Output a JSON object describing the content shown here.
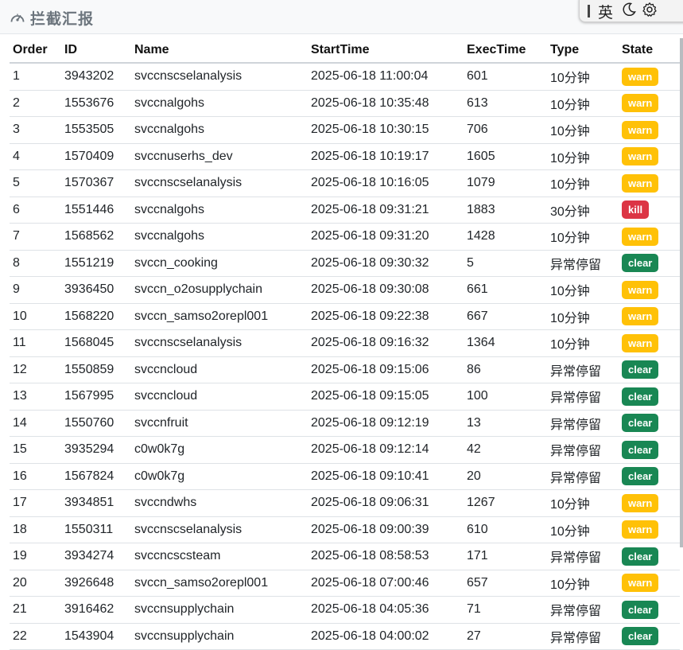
{
  "header": {
    "title": "拦截汇报",
    "icon": "gauge-icon"
  },
  "toolbar": {
    "lang_label": "英",
    "icons": [
      "separator-bar-icon",
      "moon-icon",
      "gear-icon"
    ]
  },
  "table": {
    "columns": [
      "Order",
      "ID",
      "Name",
      "StartTime",
      "ExecTime",
      "Type",
      "State"
    ],
    "rows": [
      [
        "1",
        "3943202",
        "svccnscselanalysis",
        "2025-06-18 11:00:04",
        "601",
        "10分钟",
        "warn"
      ],
      [
        "2",
        "1553676",
        "svccnalgohs",
        "2025-06-18 10:35:48",
        "613",
        "10分钟",
        "warn"
      ],
      [
        "3",
        "1553505",
        "svccnalgohs",
        "2025-06-18 10:30:15",
        "706",
        "10分钟",
        "warn"
      ],
      [
        "4",
        "1570409",
        "svccnuserhs_dev",
        "2025-06-18 10:19:17",
        "1605",
        "10分钟",
        "warn"
      ],
      [
        "5",
        "1570367",
        "svccnscselanalysis",
        "2025-06-18 10:16:05",
        "1079",
        "10分钟",
        "warn"
      ],
      [
        "6",
        "1551446",
        "svccnalgohs",
        "2025-06-18 09:31:21",
        "1883",
        "30分钟",
        "kill"
      ],
      [
        "7",
        "1568562",
        "svccnalgohs",
        "2025-06-18 09:31:20",
        "1428",
        "10分钟",
        "warn"
      ],
      [
        "8",
        "1551219",
        "svccn_cooking",
        "2025-06-18 09:30:32",
        "5",
        "异常停留",
        "clear"
      ],
      [
        "9",
        "3936450",
        "svccn_o2osupplychain",
        "2025-06-18 09:30:08",
        "661",
        "10分钟",
        "warn"
      ],
      [
        "10",
        "1568220",
        "svccn_samso2orepl001",
        "2025-06-18 09:22:38",
        "667",
        "10分钟",
        "warn"
      ],
      [
        "11",
        "1568045",
        "svccnscselanalysis",
        "2025-06-18 09:16:32",
        "1364",
        "10分钟",
        "warn"
      ],
      [
        "12",
        "1550859",
        "svccncloud",
        "2025-06-18 09:15:06",
        "86",
        "异常停留",
        "clear"
      ],
      [
        "13",
        "1567995",
        "svccncloud",
        "2025-06-18 09:15:05",
        "100",
        "异常停留",
        "clear"
      ],
      [
        "14",
        "1550760",
        "svccnfruit",
        "2025-06-18 09:12:19",
        "13",
        "异常停留",
        "clear"
      ],
      [
        "15",
        "3935294",
        "c0w0k7g",
        "2025-06-18 09:12:14",
        "42",
        "异常停留",
        "clear"
      ],
      [
        "16",
        "1567824",
        "c0w0k7g",
        "2025-06-18 09:10:41",
        "20",
        "异常停留",
        "clear"
      ],
      [
        "17",
        "3934851",
        "svccndwhs",
        "2025-06-18 09:06:31",
        "1267",
        "10分钟",
        "warn"
      ],
      [
        "18",
        "1550311",
        "svccnscselanalysis",
        "2025-06-18 09:00:39",
        "610",
        "10分钟",
        "warn"
      ],
      [
        "19",
        "3934274",
        "svccncscsteam",
        "2025-06-18 08:58:53",
        "171",
        "异常停留",
        "clear"
      ],
      [
        "20",
        "3926648",
        "svccn_samso2orepl001",
        "2025-06-18 07:00:46",
        "657",
        "10分钟",
        "warn"
      ],
      [
        "21",
        "3916462",
        "svccnsupplychain",
        "2025-06-18 04:05:36",
        "71",
        "异常停留",
        "clear"
      ],
      [
        "22",
        "1543904",
        "svccnsupplychain",
        "2025-06-18 04:00:02",
        "27",
        "异常停留",
        "clear"
      ]
    ]
  },
  "colors": {
    "warn": "#ffc107",
    "kill": "#dc3545",
    "clear": "#198754"
  }
}
